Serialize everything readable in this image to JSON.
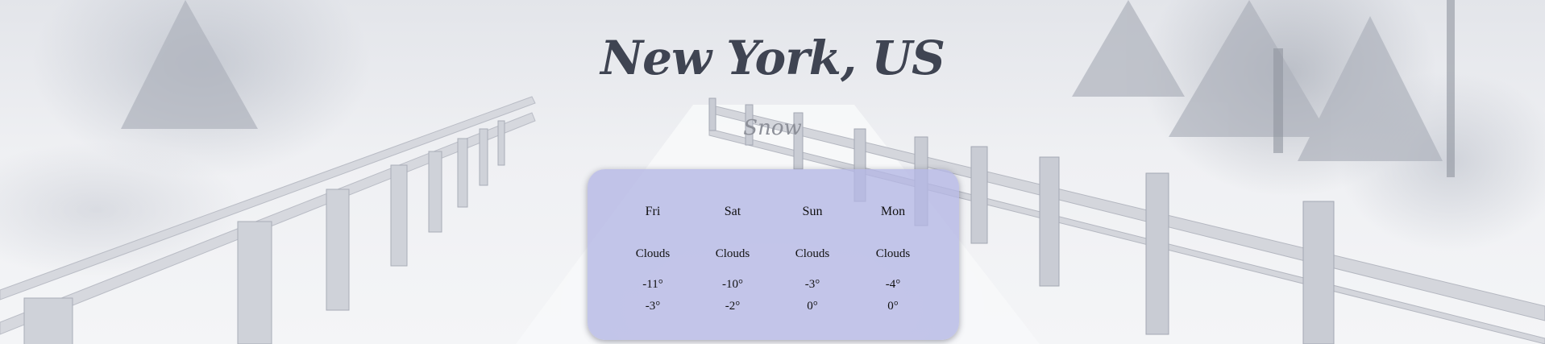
{
  "location": {
    "city": "New York, US",
    "condition": "Snow"
  },
  "forecast": [
    {
      "day": "Fri",
      "condition": "Clouds",
      "low": "-11°",
      "high": "-3°"
    },
    {
      "day": "Sat",
      "condition": "Clouds",
      "low": "-10°",
      "high": "-2°"
    },
    {
      "day": "Sun",
      "condition": "Clouds",
      "low": "-3°",
      "high": "0°"
    },
    {
      "day": "Mon",
      "condition": "Clouds",
      "low": "-4°",
      "high": "0°"
    }
  ],
  "colors": {
    "title": "#3f4452",
    "condition": "#8c8f98",
    "card_background": "#b4b6e4"
  }
}
